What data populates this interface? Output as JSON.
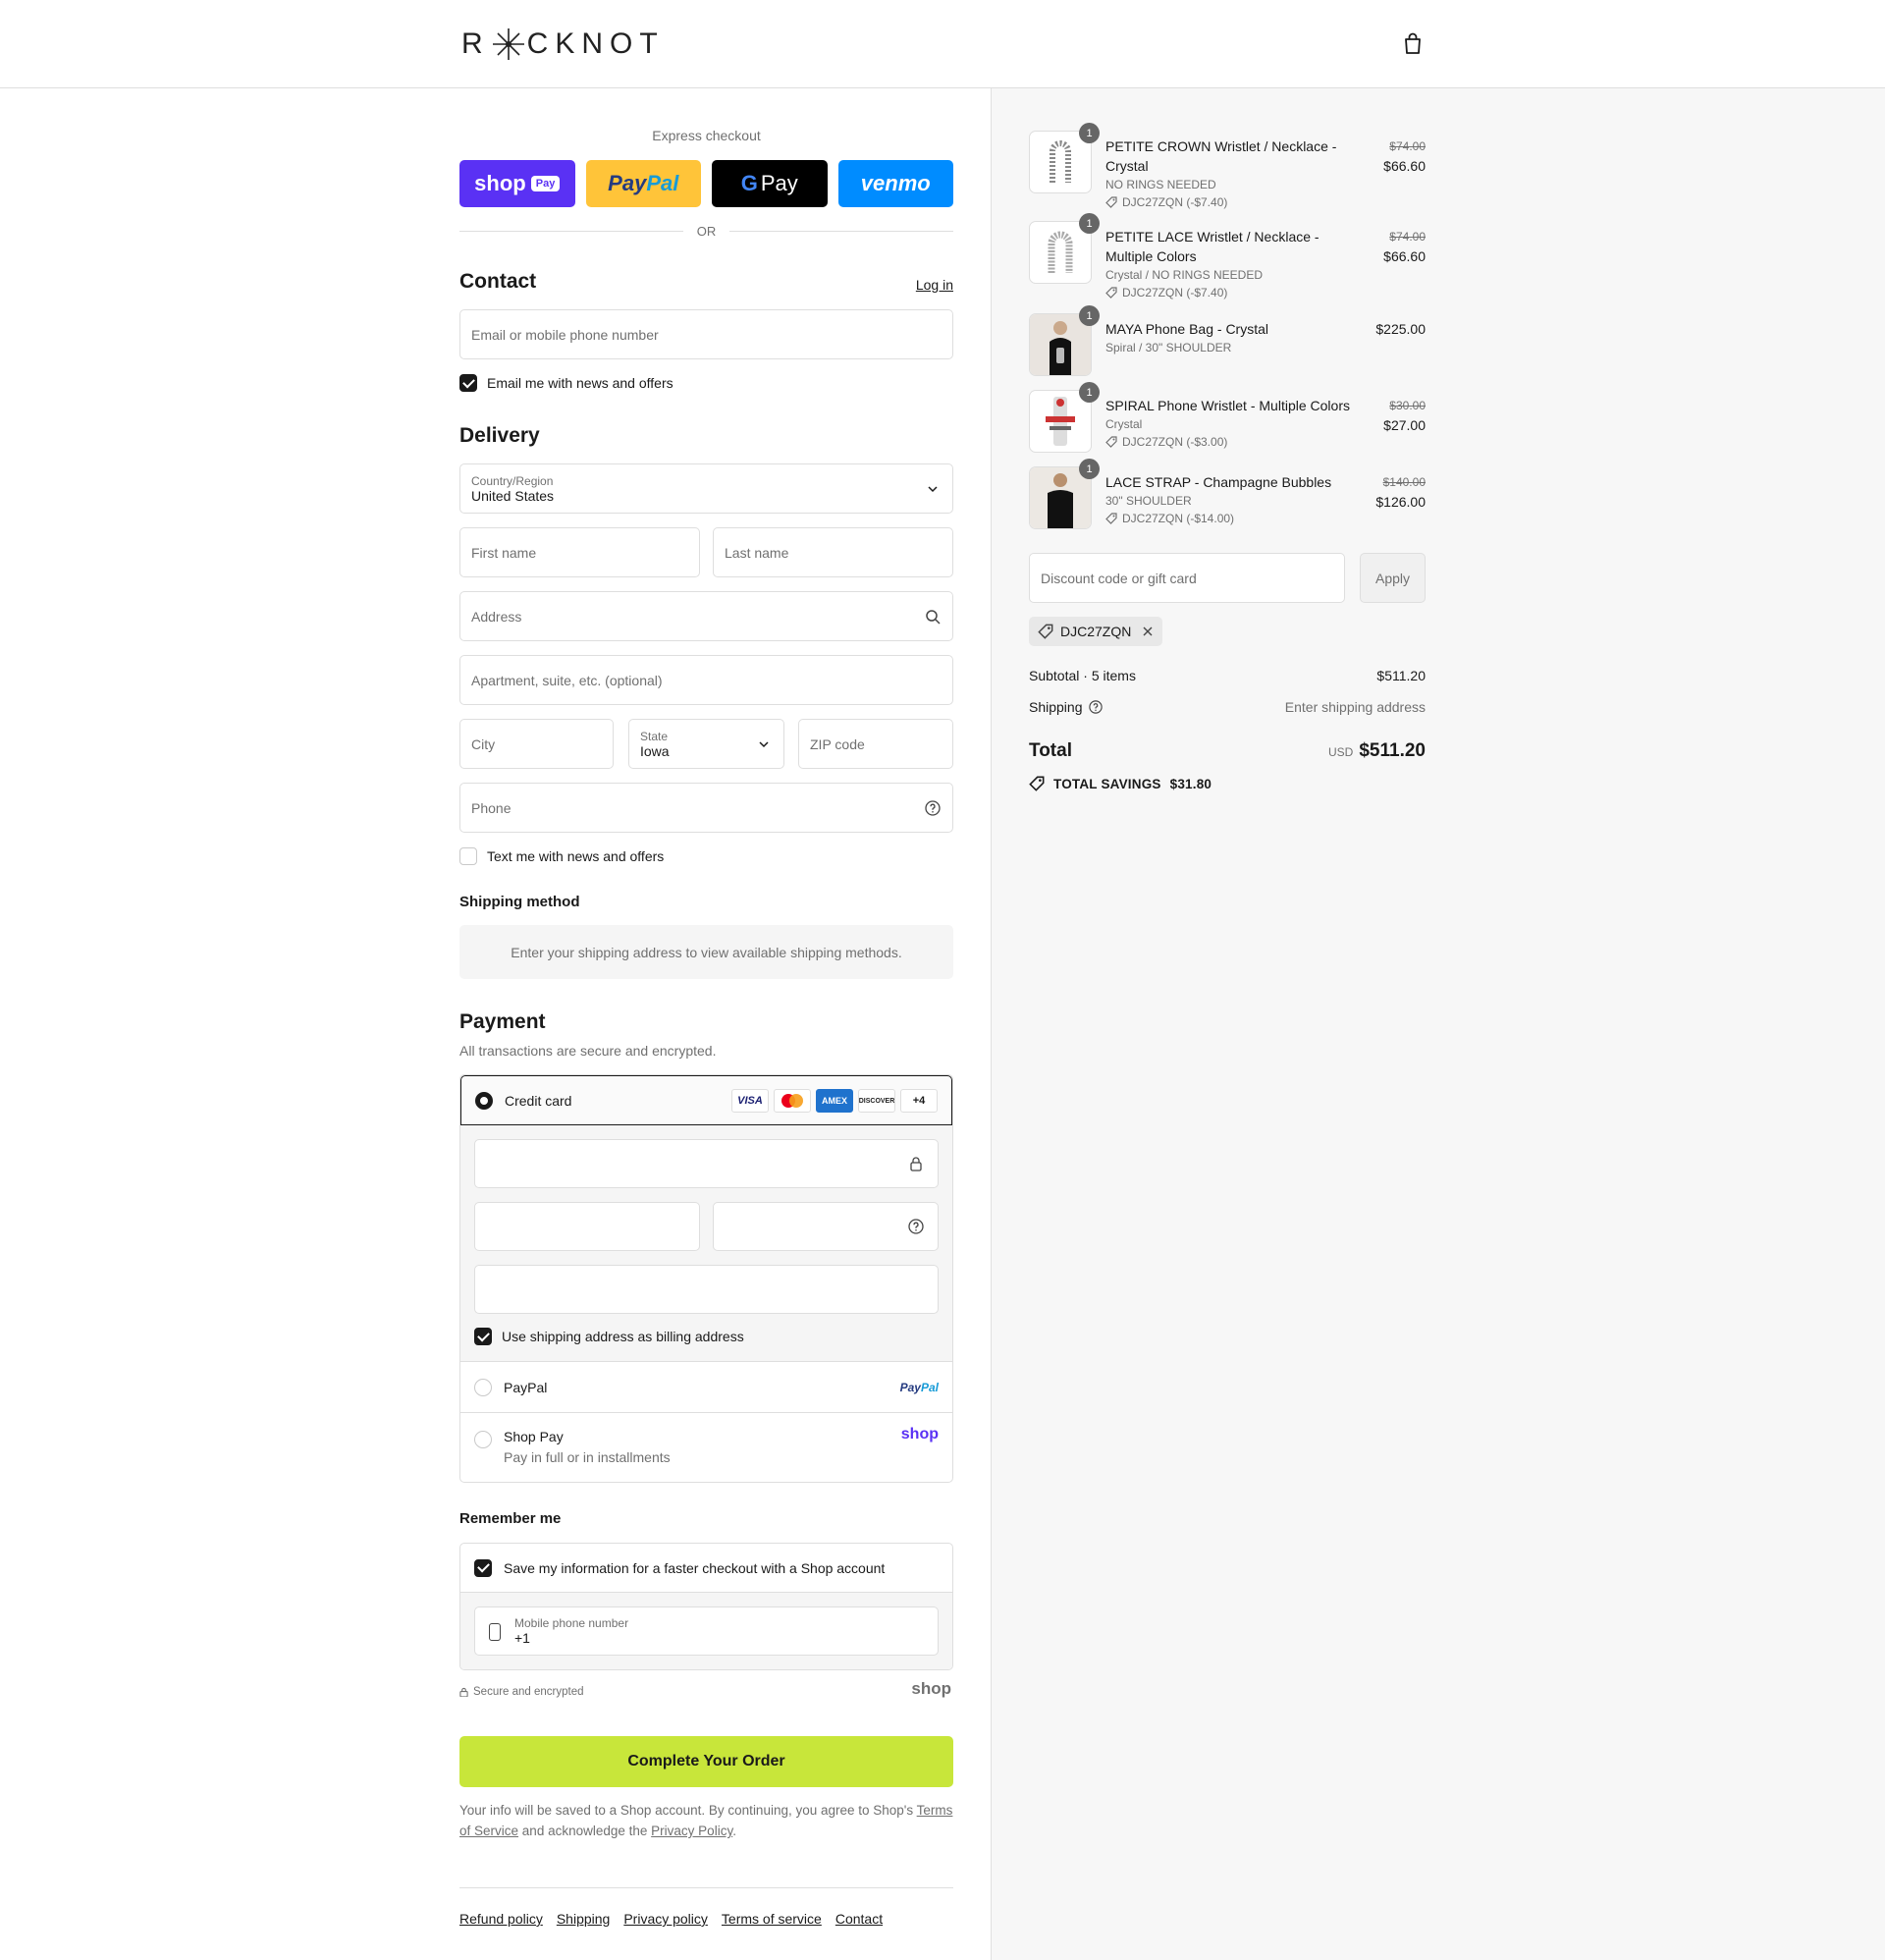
{
  "header": {
    "logo_text": "R✳CKNOT",
    "logo_left": "R",
    "logo_right": "CKNOT"
  },
  "express": {
    "title": "Express checkout",
    "shop_pay": "shop",
    "shop_pay_pill": "Pay",
    "paypal_a": "Pay",
    "paypal_b": "Pal",
    "gpay_g": "G",
    "gpay_text": "Pay",
    "venmo": "venmo",
    "or": "OR"
  },
  "contact": {
    "title": "Contact",
    "login": "Log in",
    "email_placeholder": "Email or mobile phone number",
    "news_checkbox": "Email me with news and offers",
    "news_checked": true
  },
  "delivery": {
    "title": "Delivery",
    "country_label": "Country/Region",
    "country_value": "United States",
    "first_name": "First name",
    "last_name": "Last name",
    "address": "Address",
    "apartment": "Apartment, suite, etc. (optional)",
    "city": "City",
    "state_label": "State",
    "state_value": "Iowa",
    "zip": "ZIP code",
    "phone": "Phone",
    "text_checkbox": "Text me with news and offers"
  },
  "shipping_method": {
    "title": "Shipping method",
    "message": "Enter your shipping address to view available shipping methods."
  },
  "payment": {
    "title": "Payment",
    "subtitle": "All transactions are secure and encrypted.",
    "credit_card": "Credit card",
    "cards": [
      "VISA",
      "AMEX",
      "DISCOVER",
      "+4"
    ],
    "billing_checkbox": "Use shipping address as billing address",
    "paypal": "PayPal",
    "paypal_logo_a": "Pay",
    "paypal_logo_b": "Pal",
    "shop_pay": "Shop Pay",
    "shop_pay_sub": "Pay in full or in installments",
    "shop_logo": "shop"
  },
  "remember": {
    "title": "Remember me",
    "save_checkbox": "Save my information for a faster checkout with a Shop account",
    "mobile_label": "Mobile phone number",
    "mobile_value": "+1",
    "secure": "Secure and encrypted",
    "shop_logo": "shop"
  },
  "complete_button": "Complete Your Order",
  "legal": {
    "line1": "Your info will be saved to a Shop account. By continuing, you agree to Shop's",
    "terms": "Terms of Service",
    "mid": "and acknowledge the",
    "privacy": "Privacy Policy",
    "end": "."
  },
  "footer": [
    "Refund policy",
    "Shipping",
    "Privacy policy",
    "Terms of service",
    "Contact"
  ],
  "items": [
    {
      "qty": "1",
      "name": "PETITE CROWN Wristlet / Necklace - Crystal",
      "variant": "NO RINGS NEEDED",
      "discount": "DJC27ZQN (-$7.40)",
      "old_price": "$74.00",
      "price": "$66.60"
    },
    {
      "qty": "1",
      "name": "PETITE LACE Wristlet / Necklace - Multiple Colors",
      "variant": "Crystal / NO RINGS NEEDED",
      "discount": "DJC27ZQN (-$7.40)",
      "old_price": "$74.00",
      "price": "$66.60"
    },
    {
      "qty": "1",
      "name": "MAYA Phone Bag - Crystal",
      "variant": "Spiral / 30\" SHOULDER",
      "discount": "",
      "old_price": "",
      "price": "$225.00"
    },
    {
      "qty": "1",
      "name": "SPIRAL Phone Wristlet - Multiple Colors",
      "variant": "Crystal",
      "discount": "DJC27ZQN (-$3.00)",
      "old_price": "$30.00",
      "price": "$27.00"
    },
    {
      "qty": "1",
      "name": "LACE STRAP - Champagne Bubbles",
      "variant": "30\" SHOULDER",
      "discount": "DJC27ZQN (-$14.00)",
      "old_price": "$140.00",
      "price": "$126.00"
    }
  ],
  "summary": {
    "discount_placeholder": "Discount code or gift card",
    "apply": "Apply",
    "code": "DJC27ZQN",
    "subtotal_label": "Subtotal · 5 items",
    "subtotal_value": "$511.20",
    "shipping_label": "Shipping",
    "shipping_value": "Enter shipping address",
    "total_label": "Total",
    "currency": "USD",
    "total_value": "$511.20",
    "savings_label": "TOTAL SAVINGS",
    "savings_value": "$31.80"
  },
  "colors": {
    "accent": "#c8e63a",
    "shop_purple": "#5a31f4",
    "paypal_yellow": "#ffc439",
    "venmo_blue": "#008cff"
  }
}
